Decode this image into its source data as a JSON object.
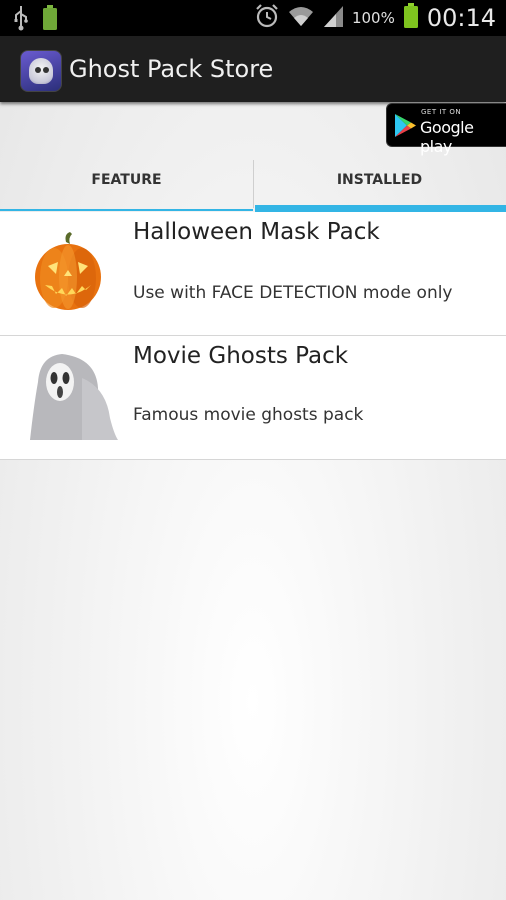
{
  "status_bar": {
    "icons_left": [
      "usb-icon",
      "battery-full-icon"
    ],
    "icons_right": [
      "alarm-icon",
      "wifi-icon",
      "signal-icon"
    ],
    "battery_percent": "100%",
    "time": "00:14"
  },
  "action_bar": {
    "title": "Ghost Pack Store"
  },
  "play_badge": {
    "get_it_on": "GET IT ON",
    "store_name": "Google play"
  },
  "tabs": [
    {
      "label": "FEATURE",
      "selected": false
    },
    {
      "label": "INSTALLED",
      "selected": true
    }
  ],
  "packs": [
    {
      "title": "Halloween Mask Pack",
      "description": "Use with FACE DETECTION mode only",
      "icon": "jack-o-lantern-icon"
    },
    {
      "title": "Movie Ghosts Pack",
      "description": "Famous movie ghosts pack",
      "icon": "scream-ghost-icon"
    }
  ],
  "colors": {
    "accent": "#33b5e5",
    "status_bar": "#000000",
    "action_bar": "#1f1f1f"
  }
}
